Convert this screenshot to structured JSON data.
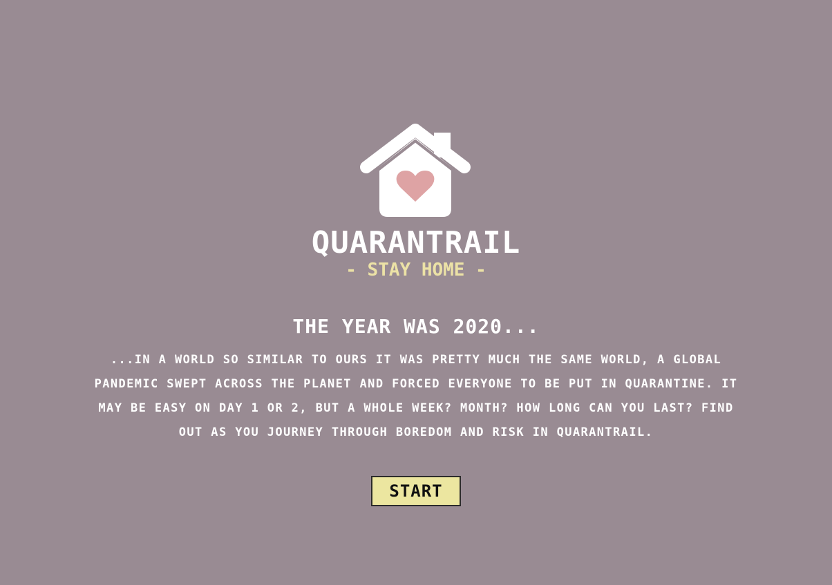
{
  "app": {
    "title": "QUARANTRAIL",
    "subtitle": "- STAY HOME -",
    "logo_icon": "house-heart-icon"
  },
  "intro": {
    "heading": "THE YEAR WAS 2020...",
    "story": "...IN A WORLD SO SIMILAR TO OURS IT WAS PRETTY MUCH THE SAME WORLD, A GLOBAL PANDEMIC SWEPT ACROSS THE PLANET AND FORCED EVERYONE TO BE PUT IN QUARANTINE. IT MAY BE EASY ON DAY 1 OR 2, BUT A WHOLE WEEK? MONTH? HOW LONG CAN YOU LAST? FIND OUT AS YOU JOURNEY THROUGH BOREDOM AND RISK IN QUARANTRAIL."
  },
  "actions": {
    "start_label": "START"
  },
  "colors": {
    "background": "#998b93",
    "accent_yellow": "#ece2a6",
    "heart_pink": "#dea3a4",
    "text_white": "#ffffff"
  }
}
